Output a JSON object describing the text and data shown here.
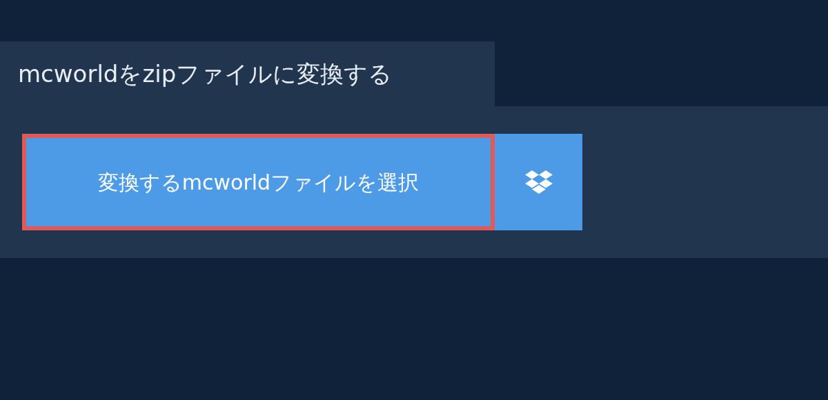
{
  "tab": {
    "title": "mcworldをzipファイルに変換する"
  },
  "file_button": {
    "label": "変換するmcworldファイルを選択",
    "focused": true
  }
}
